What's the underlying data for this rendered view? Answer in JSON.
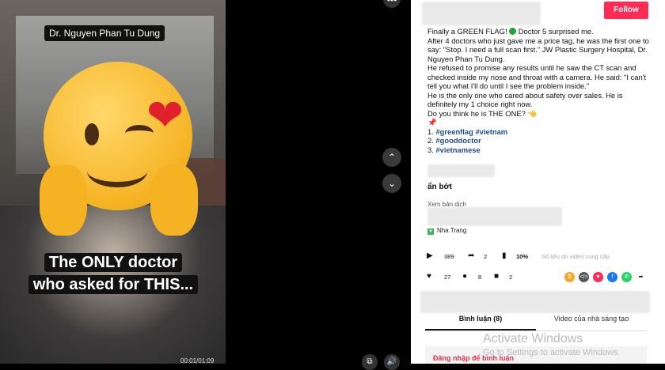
{
  "video": {
    "name_tag": "Dr. Nguyen Phan Tu Dung",
    "caption_line1": "The ONLY doctor",
    "caption_line2": "who asked for THIS...",
    "time": "00:01/01:09"
  },
  "panel": {
    "follow_label": "Follow",
    "desc_lines": [
      "Finally a GREEN FLAG!",
      "Doctor 5 surprised me.",
      "After 4 doctors who just gave me a price tag, he was the first one to say: \"Stop. I need a full scan first.\" JW Plastic Surgery Hospital, Dr. Nguyen Phan Tu Dung.",
      "He refused to promise any results until he saw the CT scan and checked inside my nose and throat with a camera. He said: \"I can't tell you what I'll do until I see the problem inside.\"",
      "He is the only one who cared about safety over sales. He is definitely my 1 choice right now.",
      "Do you think he is THE ONE?"
    ],
    "list": [
      "1. ",
      "#greenflag",
      " ",
      "#vietnam",
      "2. ",
      "#gooddoctor",
      "3. ",
      "#vietnamese"
    ],
    "collapse_label": "ẩn bớt",
    "translate_label": "Xem bản dịch",
    "location": "Nha Trang",
    "stats": {
      "plays": "389",
      "shares": "2",
      "percent": "10%",
      "note": "Số liệu do video cung cấp",
      "likes": "27",
      "comments": "8",
      "saves": "2"
    },
    "tabs": [
      "Bình luận (8)",
      "Video của nhà sáng tạo"
    ],
    "login_label": "Đăng nhập để bình luận"
  },
  "watermark": {
    "line1": "Activate Windows",
    "line2": "Go to Settings to activate Windows."
  },
  "colors": {
    "accent": "#fe2c55",
    "hashtag": "#1e4e8c"
  }
}
